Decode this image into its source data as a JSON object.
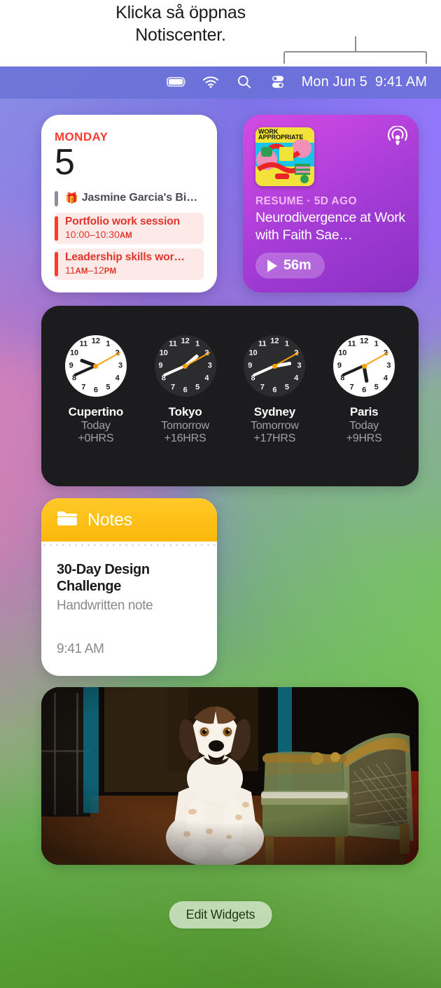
{
  "annotation": {
    "text_line1": "Klicka så öppnas",
    "text_line2": "Notiscenter."
  },
  "menubar": {
    "icons": [
      "battery-icon",
      "wifi-icon",
      "search-icon",
      "control-center-icon"
    ],
    "date": "Mon Jun 5",
    "time": "9:41 AM"
  },
  "calendar": {
    "weekday": "MONDAY",
    "date_number": "5",
    "events": [
      {
        "title": "Jasmine Garcia's Bi…",
        "time": "",
        "kind": "allday",
        "bar_color": "#8e8e9a",
        "icon": "gift-icon"
      },
      {
        "title": "Portfolio work session",
        "time_start": "10:00–10:30",
        "ampm": "AM",
        "kind": "timed",
        "bar_color": "#ff3b30"
      },
      {
        "title": "Leadership skills wor…",
        "time_start": "11",
        "ampm": "AM",
        "time_end": "–12",
        "ampm2": "PM",
        "kind": "timed",
        "bar_color": "#ff3b30"
      }
    ]
  },
  "podcast": {
    "artwork_title_line1": "WORK",
    "artwork_title_line2": "APPROPRIATE",
    "app_icon": "podcasts-icon",
    "meta": "RESUME · 5D AGO",
    "title": "Neurodivergence at Work with Faith Sae…",
    "duration": "56m",
    "play_icon": "play-icon"
  },
  "clocks": {
    "items": [
      {
        "city": "Cupertino",
        "day": "Today",
        "offset": "+0HRS",
        "theme": "light",
        "hour_deg": 290,
        "minute_deg": 246,
        "second_deg": 61
      },
      {
        "city": "Tokyo",
        "day": "Tomorrow",
        "offset": "+16HRS",
        "theme": "dark",
        "hour_deg": 50,
        "minute_deg": 246,
        "second_deg": 61
      },
      {
        "city": "Sydney",
        "day": "Tomorrow",
        "offset": "+17HRS",
        "theme": "dark",
        "hour_deg": 80,
        "minute_deg": 246,
        "second_deg": 61
      },
      {
        "city": "Paris",
        "day": "Today",
        "offset": "+9HRS",
        "theme": "light",
        "hour_deg": 170,
        "minute_deg": 246,
        "second_deg": 61
      }
    ],
    "numerals": [
      "12",
      "1",
      "2",
      "3",
      "4",
      "5",
      "6",
      "7",
      "8",
      "9",
      "10",
      "11"
    ]
  },
  "notes": {
    "folder_icon": "folder-icon",
    "header": "Notes",
    "note_title": "30-Day Design Challenge",
    "note_subtitle": "Handwritten note",
    "note_time": "9:41 AM"
  },
  "photo": {
    "description": "Dog sitting on a wooden floor beside a green antique chair"
  },
  "footer": {
    "edit_widgets_label": "Edit Widgets"
  },
  "colors": {
    "accent_red": "#ff3b30",
    "notes_yellow": "#fcb80a",
    "podcast_purple": "#a13bd4",
    "clock_second_hand": "#ff9f0a",
    "menubar": "#6870d6"
  }
}
